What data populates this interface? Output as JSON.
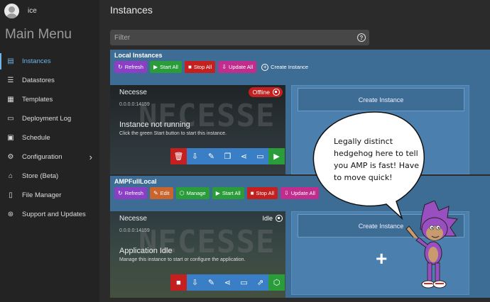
{
  "user": {
    "name": "ice"
  },
  "sidebar": {
    "title": "Main Menu",
    "items": [
      {
        "label": "Instances",
        "icon": "server-icon",
        "glyph": "▤"
      },
      {
        "label": "Datastores",
        "icon": "datastore-icon",
        "glyph": "☰"
      },
      {
        "label": "Templates",
        "icon": "template-icon",
        "glyph": "▦"
      },
      {
        "label": "Deployment Log",
        "icon": "log-icon",
        "glyph": "▭"
      },
      {
        "label": "Schedule",
        "icon": "calendar-icon",
        "glyph": "▣"
      },
      {
        "label": "Configuration",
        "icon": "gear-icon",
        "glyph": "⚙",
        "chevron": "›"
      },
      {
        "label": "Store (Beta)",
        "icon": "store-icon",
        "glyph": "⌂"
      },
      {
        "label": "File Manager",
        "icon": "file-icon",
        "glyph": "▯"
      },
      {
        "label": "Support and Updates",
        "icon": "support-icon",
        "glyph": "⊛"
      }
    ]
  },
  "page": {
    "title": "Instances"
  },
  "filter": {
    "placeholder": "Filter",
    "help_glyph": "?"
  },
  "groups": [
    {
      "title": "Local Instances",
      "buttons": [
        {
          "label": "Refresh",
          "icon": "refresh-icon",
          "glyph": "↻",
          "color": "#8a3fc4"
        },
        {
          "label": "Start All",
          "icon": "play-icon",
          "glyph": "▶",
          "color": "#2a9d3a"
        },
        {
          "label": "Stop All",
          "icon": "stop-icon",
          "glyph": "■",
          "color": "#c42020"
        },
        {
          "label": "Update All",
          "icon": "download-icon",
          "glyph": "⇩",
          "color": "#c12d8c"
        },
        {
          "label": "Create Instance",
          "icon": "plus-circle-icon",
          "glyph": "+",
          "color": "#3d6d95"
        }
      ],
      "instance": {
        "name": "Necesse",
        "logo": "NECESSE",
        "version": "0.0.0.0:14159",
        "status": "Instance not running",
        "hint": "Click the green Start button to start this instance.",
        "badge": "Offline",
        "actions": [
          {
            "name": "delete-icon",
            "glyph": "🗑"
          },
          {
            "name": "update-icon",
            "glyph": "⇩"
          },
          {
            "name": "edit-icon",
            "glyph": "✎"
          },
          {
            "name": "copy-icon",
            "glyph": "❐"
          },
          {
            "name": "share-icon",
            "glyph": "⋖"
          },
          {
            "name": "folder-icon",
            "glyph": "▭"
          },
          {
            "name": "play-icon",
            "glyph": "▶"
          }
        ]
      },
      "create_label": "Create Instance"
    },
    {
      "title": "AMPFullLocal",
      "buttons": [
        {
          "label": "Refresh",
          "icon": "refresh-icon",
          "glyph": "↻",
          "color": "#8a3fc4"
        },
        {
          "label": "Edit",
          "icon": "edit-icon",
          "glyph": "✎",
          "color": "#c9642d"
        },
        {
          "label": "Manage",
          "icon": "cube-icon",
          "glyph": "⬡",
          "color": "#2a9d3a"
        },
        {
          "label": "Start All",
          "icon": "play-icon",
          "glyph": "▶",
          "color": "#2a9d3a"
        },
        {
          "label": "Stop All",
          "icon": "stop-icon",
          "glyph": "■",
          "color": "#c42020"
        },
        {
          "label": "Update All",
          "icon": "download-icon",
          "glyph": "⇩",
          "color": "#c12d8c"
        }
      ],
      "instance": {
        "name": "Necesse",
        "logo": "NECESSE",
        "version": "0.0.0.0:14159",
        "status": "Application Idle",
        "hint": "Manage this instance to start or configure the application.",
        "badge": "Idle",
        "actions": [
          {
            "name": "stop-icon",
            "glyph": "■"
          },
          {
            "name": "update-icon",
            "glyph": "⇩"
          },
          {
            "name": "edit-icon",
            "glyph": "✎"
          },
          {
            "name": "share-icon",
            "glyph": "⋖"
          },
          {
            "name": "folder-icon",
            "glyph": "▭"
          },
          {
            "name": "open-external-icon",
            "glyph": "⇗"
          },
          {
            "name": "cube-icon",
            "glyph": "⬡"
          }
        ]
      },
      "create_label": "Create Instance",
      "create_glyph": "+"
    }
  ],
  "bubble": {
    "text": "Legally distinct hedgehog here to tell you AMP is fast! Have to move quick!"
  },
  "colors": {
    "accent": "#6eb4e6",
    "group_bg": "#3d6d95",
    "create_panel": "#4b7fae"
  }
}
